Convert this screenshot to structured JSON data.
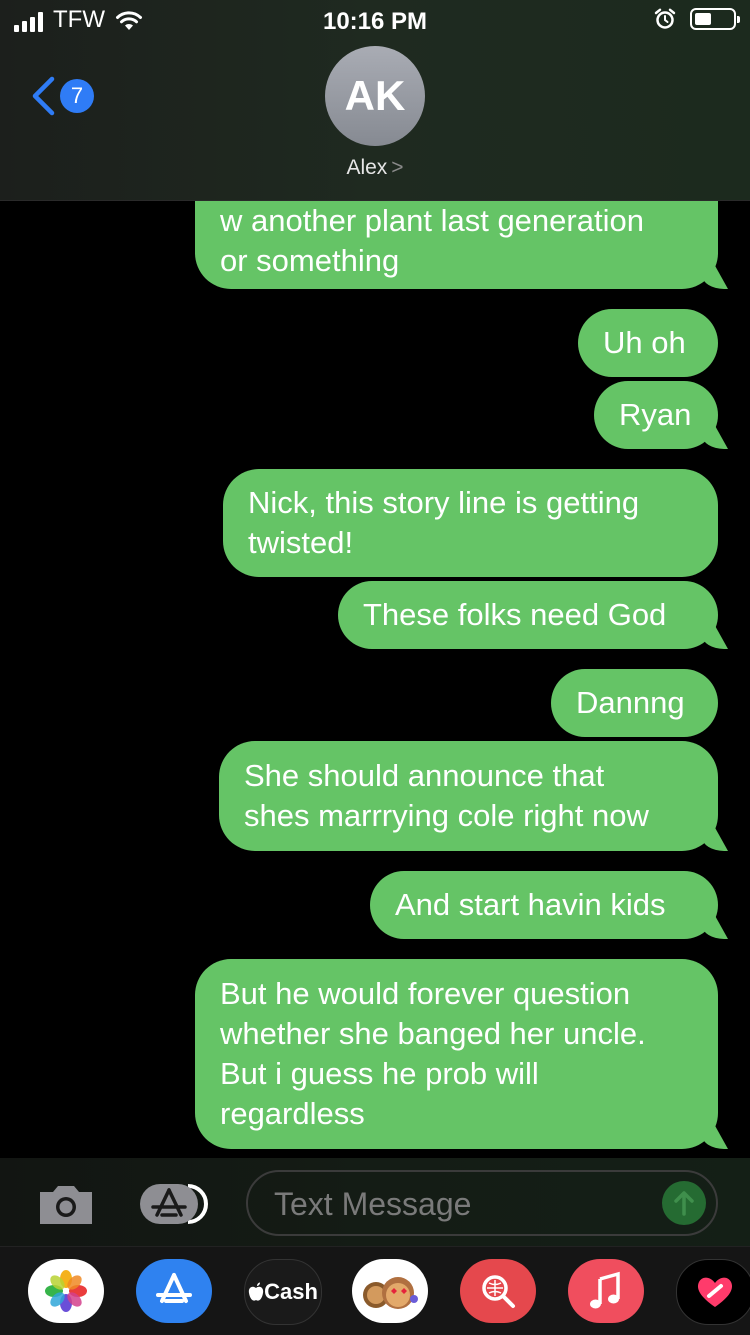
{
  "status_bar": {
    "carrier": "TFW",
    "time": "10:16 PM",
    "battery_level": 0.45
  },
  "header": {
    "back_count": "7",
    "avatar_initials": "AK",
    "contact_name": "Alex",
    "contact_chevron": ">"
  },
  "messages": [
    {
      "lines": [
        "w another plant last generation",
        "or something"
      ]
    },
    {
      "lines": [
        "Uh oh"
      ]
    },
    {
      "lines": [
        "Ryan"
      ]
    },
    {
      "lines": [
        "Nick, this story line is getting",
        "twisted!"
      ]
    },
    {
      "lines": [
        "These folks need God"
      ]
    },
    {
      "lines": [
        "Dannng"
      ]
    },
    {
      "lines": [
        "She should announce that",
        "shes marrrying cole right now"
      ]
    },
    {
      "lines": [
        "And start havin kids"
      ]
    },
    {
      "lines": [
        "But he would forever question",
        "whether she banged her uncle.",
        "But i guess he prob will",
        "regardless"
      ]
    }
  ],
  "input": {
    "placeholder": "Text Message"
  },
  "app_drawer": {
    "items": [
      "photos-app",
      "app-store",
      "apple-cash",
      "memoji",
      "web-search",
      "music",
      "heart-app"
    ],
    "cash_label": "Cash"
  },
  "colors": {
    "bubble": "#65c466",
    "badge": "#2f7cf6",
    "background": "#000000"
  }
}
